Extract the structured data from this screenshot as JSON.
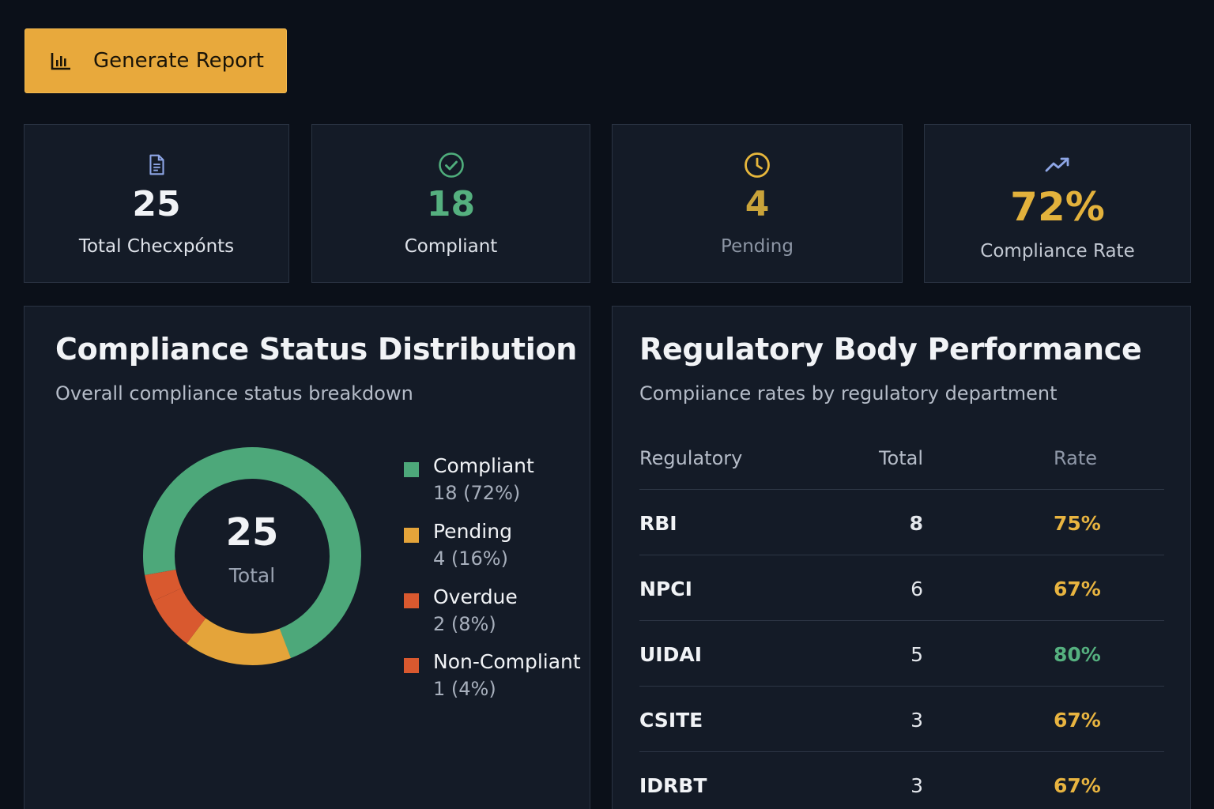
{
  "toolbar": {
    "generate_label": "Generate Report"
  },
  "stats": [
    {
      "icon": "document-icon",
      "value": "25",
      "label": "Total Checxpónts",
      "color": "#f1f3f6"
    },
    {
      "icon": "check-circle-icon",
      "value": "18",
      "label": "Compliant",
      "color": "#55b07f"
    },
    {
      "icon": "clock-icon",
      "value": "4",
      "label": "Pending",
      "color": "#c9a33a"
    },
    {
      "icon": "trending-up-icon",
      "value": "72%",
      "label": "Compliance Rate",
      "color": "#e3b23c"
    }
  ],
  "distribution": {
    "title": "Compliance Status Distribution",
    "subtitle": "Overall compliance status breakdown",
    "total_value": "25",
    "total_label": "Total",
    "chart_data": {
      "type": "pie",
      "categories": [
        "Compliant",
        "Pending",
        "Overdue",
        "Non-Compliant"
      ],
      "values": [
        18,
        4,
        2,
        1
      ],
      "labels": [
        "18 (72%)",
        "4 (16%)",
        "2 (8%)",
        "1 (4%)"
      ],
      "colors": [
        "#4da87a",
        "#e4a43a",
        "#d9592f",
        "#d9592f"
      ]
    }
  },
  "performance": {
    "title": "Regulatory Body Performance",
    "subtitle": "Compiiance rates by regulatory department",
    "columns": [
      "Regulatory",
      "Total",
      "Rate"
    ],
    "rows": [
      {
        "name": "RBI",
        "total": "8",
        "rate": "75%",
        "color": "#e8b440"
      },
      {
        "name": "NPCI",
        "total": "6",
        "rate": "67%",
        "color": "#e8b440"
      },
      {
        "name": "UIDAI",
        "total": "5",
        "rate": "80%",
        "color": "#55b07f"
      },
      {
        "name": "CSITE",
        "total": "3",
        "rate": "67%",
        "color": "#e8b440"
      },
      {
        "name": "IDRBT",
        "total": "3",
        "rate": "67%",
        "color": "#e8b440"
      }
    ]
  }
}
